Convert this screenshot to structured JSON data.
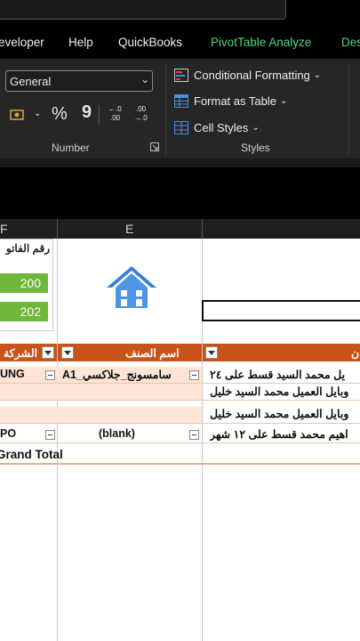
{
  "menu": {
    "tabs": [
      "eveloper",
      "Help",
      "QuickBooks",
      "PivotTable Analyze",
      "Des"
    ]
  },
  "ribbon": {
    "number_format": "General",
    "percent_symbol": "%",
    "comma_symbol": "9",
    "increase_decimal": "←.0 .00",
    "decrease_decimal": ".00 →.0",
    "number_group_label": "Number",
    "styles_group_label": "Styles",
    "conditional_formatting": "Conditional Formatting",
    "format_as_table": "Format as Table",
    "cell_styles": "Cell Styles"
  },
  "columns": {
    "f": "F",
    "e": "E"
  },
  "invoice": {
    "label": "رقم الفاتو",
    "values": [
      "200",
      "202"
    ]
  },
  "pivot": {
    "headers": {
      "company": "الشركة",
      "item": "اسم الصنف",
      "customer": "ن"
    },
    "rows": [
      {
        "company": "UNG",
        "item": "سامسونج_جلاكسي_A1",
        "customer": "يل محمد السيد قسط على ٢٤"
      },
      {
        "company": "",
        "item": "",
        "customer": "وبايل العميل محمد السيد خليل"
      },
      {
        "company": "",
        "item": "",
        "customer": "وبايل  العميل محمد السيد خليل"
      },
      {
        "company": "PO",
        "item": "(blank)",
        "customer": "اهيم محمد قسط على ١٢ شهر"
      }
    ],
    "grand_total": "Grand Total"
  },
  "colors": {
    "accent_green": "#6fb83b",
    "pivot_header": "#c9541a",
    "tab_green": "#4fd37a"
  }
}
